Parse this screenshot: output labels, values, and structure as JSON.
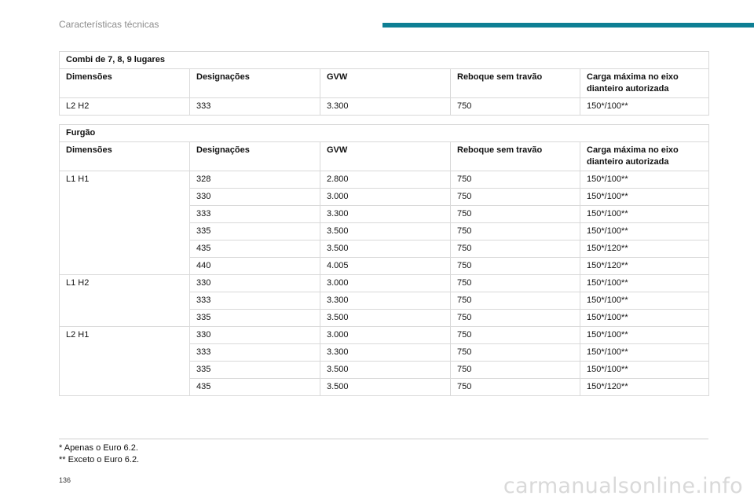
{
  "header": {
    "section_title": "Características técnicas",
    "accent_color": "#0e7f94"
  },
  "tables": [
    {
      "section": "Combi de 7, 8, 9 lugares",
      "columns": [
        "Dimensões",
        "Designações",
        "GVW",
        "Reboque sem travão",
        "Carga máxima no eixo dianteiro autorizada"
      ],
      "rows": [
        {
          "dim": "L2 H2",
          "des": "333",
          "gvw": "3.300",
          "tow": "750",
          "load": "150*/100**"
        }
      ]
    },
    {
      "section": "Furgão",
      "columns": [
        "Dimensões",
        "Designações",
        "GVW",
        "Reboque sem travão",
        "Carga máxima no eixo dianteiro autorizada"
      ],
      "rows": [
        {
          "dim": "L1 H1",
          "des": "328",
          "gvw": "2.800",
          "tow": "750",
          "load": "150*/100**"
        },
        {
          "dim": "",
          "des": "330",
          "gvw": "3.000",
          "tow": "750",
          "load": "150*/100**"
        },
        {
          "dim": "",
          "des": "333",
          "gvw": "3.300",
          "tow": "750",
          "load": "150*/100**"
        },
        {
          "dim": "",
          "des": "335",
          "gvw": "3.500",
          "tow": "750",
          "load": "150*/100**"
        },
        {
          "dim": "",
          "des": "435",
          "gvw": "3.500",
          "tow": "750",
          "load": "150*/120**"
        },
        {
          "dim": "",
          "des": "440",
          "gvw": "4.005",
          "tow": "750",
          "load": "150*/120**"
        },
        {
          "dim": "L1 H2",
          "des": "330",
          "gvw": "3.000",
          "tow": "750",
          "load": "150*/100**"
        },
        {
          "dim": "",
          "des": "333",
          "gvw": "3.300",
          "tow": "750",
          "load": "150*/100**"
        },
        {
          "dim": "",
          "des": "335",
          "gvw": "3.500",
          "tow": "750",
          "load": "150*/100**"
        },
        {
          "dim": "L2 H1",
          "des": "330",
          "gvw": "3.000",
          "tow": "750",
          "load": "150*/100**"
        },
        {
          "dim": "",
          "des": "333",
          "gvw": "3.300",
          "tow": "750",
          "load": "150*/100**"
        },
        {
          "dim": "",
          "des": "335",
          "gvw": "3.500",
          "tow": "750",
          "load": "150*/100**"
        },
        {
          "dim": "",
          "des": "435",
          "gvw": "3.500",
          "tow": "750",
          "load": "150*/120**"
        }
      ]
    }
  ],
  "footnotes": [
    "* Apenas o Euro 6.2.",
    "** Exceto o Euro 6.2."
  ],
  "page_number": "136",
  "watermark": "carmanualsonline.info"
}
